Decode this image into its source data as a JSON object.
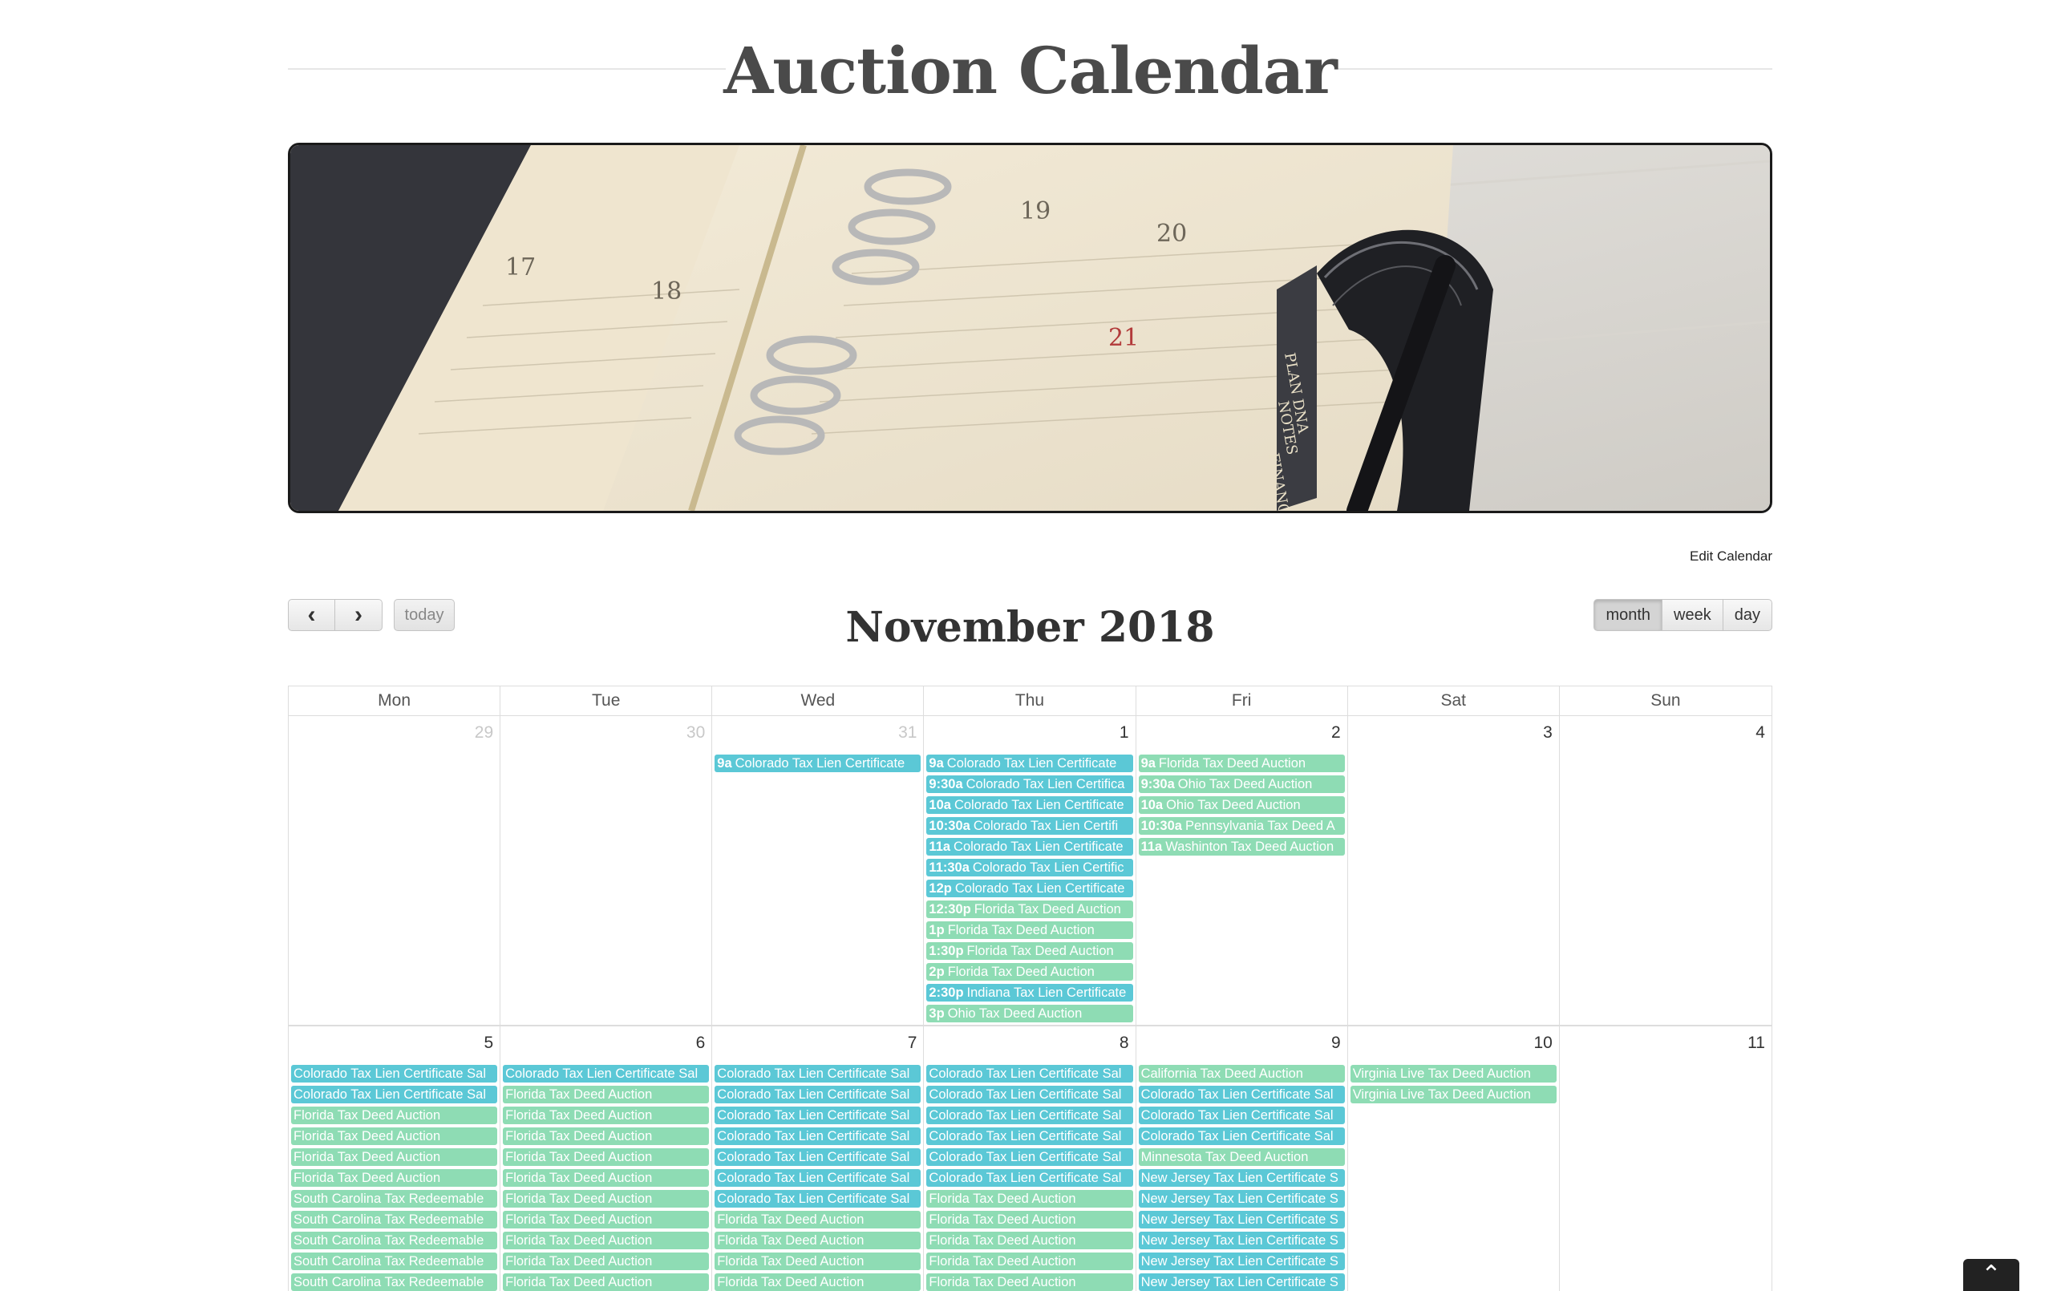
{
  "page": {
    "title": "Auction Calendar",
    "edit_link": "Edit Calendar"
  },
  "hero": {
    "image_name": "planner-photo",
    "dates": [
      "17",
      "18",
      "19",
      "20",
      "21"
    ],
    "tabs": [
      "PLAN DNA",
      "NOTES",
      "FINANCE"
    ]
  },
  "toolbar": {
    "prev_icon": "chevron-left-icon",
    "next_icon": "chevron-right-icon",
    "prev_glyph": "‹",
    "next_glyph": "›",
    "today_label": "today",
    "month_label": "month",
    "week_label": "week",
    "day_label": "day"
  },
  "calendar": {
    "title": "November 2018",
    "day_headers": [
      "Mon",
      "Tue",
      "Wed",
      "Thu",
      "Fri",
      "Sat",
      "Sun"
    ],
    "colors": {
      "blue": "#5bc8d6",
      "green": "#8edcb4"
    },
    "weeks": [
      {
        "days": [
          {
            "num": "29",
            "other": true,
            "events": []
          },
          {
            "num": "30",
            "other": true,
            "events": []
          },
          {
            "num": "31",
            "other": true,
            "events": [
              {
                "time": "9a",
                "title": "Colorado Tax Lien Certificate",
                "color": "blue"
              }
            ]
          },
          {
            "num": "1",
            "other": false,
            "events": [
              {
                "time": "9a",
                "title": "Colorado Tax Lien Certificate",
                "color": "blue"
              },
              {
                "time": "9:30a",
                "title": "Colorado Tax Lien Certifica",
                "color": "blue"
              },
              {
                "time": "10a",
                "title": "Colorado Tax Lien Certificate",
                "color": "blue"
              },
              {
                "time": "10:30a",
                "title": "Colorado Tax Lien Certifi",
                "color": "blue"
              },
              {
                "time": "11a",
                "title": "Colorado Tax Lien Certificate",
                "color": "blue"
              },
              {
                "time": "11:30a",
                "title": "Colorado Tax Lien Certific",
                "color": "blue"
              },
              {
                "time": "12p",
                "title": "Colorado Tax Lien Certificate",
                "color": "blue"
              },
              {
                "time": "12:30p",
                "title": "Florida Tax Deed Auction",
                "color": "green"
              },
              {
                "time": "1p",
                "title": "Florida Tax Deed Auction",
                "color": "green"
              },
              {
                "time": "1:30p",
                "title": "Florida Tax Deed Auction",
                "color": "green"
              },
              {
                "time": "2p",
                "title": "Florida Tax Deed Auction",
                "color": "green"
              },
              {
                "time": "2:30p",
                "title": "Indiana Tax Lien Certificate",
                "color": "blue"
              },
              {
                "time": "3p",
                "title": "Ohio Tax Deed Auction",
                "color": "green"
              }
            ]
          },
          {
            "num": "2",
            "other": false,
            "events": [
              {
                "time": "9a",
                "title": "Florida Tax Deed Auction",
                "color": "green"
              },
              {
                "time": "9:30a",
                "title": "Ohio Tax Deed Auction",
                "color": "green"
              },
              {
                "time": "10a",
                "title": "Ohio Tax Deed Auction",
                "color": "green"
              },
              {
                "time": "10:30a",
                "title": "Pennsylvania Tax Deed A",
                "color": "green"
              },
              {
                "time": "11a",
                "title": "Washinton Tax Deed Auction",
                "color": "green"
              }
            ]
          },
          {
            "num": "3",
            "other": false,
            "events": []
          },
          {
            "num": "4",
            "other": false,
            "events": []
          }
        ]
      },
      {
        "days": [
          {
            "num": "5",
            "other": false,
            "events": [
              {
                "time": "",
                "title": "Colorado Tax Lien Certificate Sal",
                "color": "blue"
              },
              {
                "time": "",
                "title": "Colorado Tax Lien Certificate Sal",
                "color": "blue"
              },
              {
                "time": "",
                "title": "Florida Tax Deed Auction",
                "color": "green"
              },
              {
                "time": "",
                "title": "Florida Tax Deed Auction",
                "color": "green"
              },
              {
                "time": "",
                "title": "Florida Tax Deed Auction",
                "color": "green"
              },
              {
                "time": "",
                "title": "Florida Tax Deed Auction",
                "color": "green"
              },
              {
                "time": "",
                "title": "South Carolina Tax Redeemable",
                "color": "green"
              },
              {
                "time": "",
                "title": "South Carolina Tax Redeemable",
                "color": "green"
              },
              {
                "time": "",
                "title": "South Carolina Tax Redeemable",
                "color": "green"
              },
              {
                "time": "",
                "title": "South Carolina Tax Redeemable",
                "color": "green"
              },
              {
                "time": "",
                "title": "South Carolina Tax Redeemable",
                "color": "green"
              }
            ]
          },
          {
            "num": "6",
            "other": false,
            "events": [
              {
                "time": "",
                "title": "Colorado Tax Lien Certificate Sal",
                "color": "blue"
              },
              {
                "time": "",
                "title": "Florida Tax Deed Auction",
                "color": "green"
              },
              {
                "time": "",
                "title": "Florida Tax Deed Auction",
                "color": "green"
              },
              {
                "time": "",
                "title": "Florida Tax Deed Auction",
                "color": "green"
              },
              {
                "time": "",
                "title": "Florida Tax Deed Auction",
                "color": "green"
              },
              {
                "time": "",
                "title": "Florida Tax Deed Auction",
                "color": "green"
              },
              {
                "time": "",
                "title": "Florida Tax Deed Auction",
                "color": "green"
              },
              {
                "time": "",
                "title": "Florida Tax Deed Auction",
                "color": "green"
              },
              {
                "time": "",
                "title": "Florida Tax Deed Auction",
                "color": "green"
              },
              {
                "time": "",
                "title": "Florida Tax Deed Auction",
                "color": "green"
              },
              {
                "time": "",
                "title": "Florida Tax Deed Auction",
                "color": "green"
              }
            ]
          },
          {
            "num": "7",
            "other": false,
            "events": [
              {
                "time": "",
                "title": "Colorado Tax Lien Certificate Sal",
                "color": "blue"
              },
              {
                "time": "",
                "title": "Colorado Tax Lien Certificate Sal",
                "color": "blue"
              },
              {
                "time": "",
                "title": "Colorado Tax Lien Certificate Sal",
                "color": "blue"
              },
              {
                "time": "",
                "title": "Colorado Tax Lien Certificate Sal",
                "color": "blue"
              },
              {
                "time": "",
                "title": "Colorado Tax Lien Certificate Sal",
                "color": "blue"
              },
              {
                "time": "",
                "title": "Colorado Tax Lien Certificate Sal",
                "color": "blue"
              },
              {
                "time": "",
                "title": "Colorado Tax Lien Certificate Sal",
                "color": "blue"
              },
              {
                "time": "",
                "title": "Florida Tax Deed Auction",
                "color": "green"
              },
              {
                "time": "",
                "title": "Florida Tax Deed Auction",
                "color": "green"
              },
              {
                "time": "",
                "title": "Florida Tax Deed Auction",
                "color": "green"
              },
              {
                "time": "",
                "title": "Florida Tax Deed Auction",
                "color": "green"
              }
            ]
          },
          {
            "num": "8",
            "other": false,
            "events": [
              {
                "time": "",
                "title": "Colorado Tax Lien Certificate Sal",
                "color": "blue"
              },
              {
                "time": "",
                "title": "Colorado Tax Lien Certificate Sal",
                "color": "blue"
              },
              {
                "time": "",
                "title": "Colorado Tax Lien Certificate Sal",
                "color": "blue"
              },
              {
                "time": "",
                "title": "Colorado Tax Lien Certificate Sal",
                "color": "blue"
              },
              {
                "time": "",
                "title": "Colorado Tax Lien Certificate Sal",
                "color": "blue"
              },
              {
                "time": "",
                "title": "Colorado Tax Lien Certificate Sal",
                "color": "blue"
              },
              {
                "time": "",
                "title": "Florida Tax Deed Auction",
                "color": "green"
              },
              {
                "time": "",
                "title": "Florida Tax Deed Auction",
                "color": "green"
              },
              {
                "time": "",
                "title": "Florida Tax Deed Auction",
                "color": "green"
              },
              {
                "time": "",
                "title": "Florida Tax Deed Auction",
                "color": "green"
              },
              {
                "time": "",
                "title": "Florida Tax Deed Auction",
                "color": "green"
              }
            ]
          },
          {
            "num": "9",
            "other": false,
            "events": [
              {
                "time": "",
                "title": "California Tax Deed Auction",
                "color": "green"
              },
              {
                "time": "",
                "title": "Colorado Tax Lien Certificate Sal",
                "color": "blue"
              },
              {
                "time": "",
                "title": "Colorado Tax Lien Certificate Sal",
                "color": "blue"
              },
              {
                "time": "",
                "title": "Colorado Tax Lien Certificate Sal",
                "color": "blue"
              },
              {
                "time": "",
                "title": "Minnesota Tax Deed Auction",
                "color": "green"
              },
              {
                "time": "",
                "title": "New Jersey Tax Lien Certificate S",
                "color": "blue"
              },
              {
                "time": "",
                "title": "New Jersey Tax Lien Certificate S",
                "color": "blue"
              },
              {
                "time": "",
                "title": "New Jersey Tax Lien Certificate S",
                "color": "blue"
              },
              {
                "time": "",
                "title": "New Jersey Tax Lien Certificate S",
                "color": "blue"
              },
              {
                "time": "",
                "title": "New Jersey Tax Lien Certificate S",
                "color": "blue"
              },
              {
                "time": "",
                "title": "New Jersey Tax Lien Certificate S",
                "color": "blue"
              }
            ]
          },
          {
            "num": "10",
            "other": false,
            "events": [
              {
                "time": "",
                "title": "Virginia Live Tax Deed Auction",
                "color": "green"
              },
              {
                "time": "",
                "title": "Virginia Live Tax Deed Auction",
                "color": "green"
              }
            ]
          },
          {
            "num": "11",
            "other": false,
            "events": []
          }
        ]
      }
    ]
  },
  "scroll_top": {
    "icon": "chevron-up-icon",
    "glyph": "⌃"
  }
}
